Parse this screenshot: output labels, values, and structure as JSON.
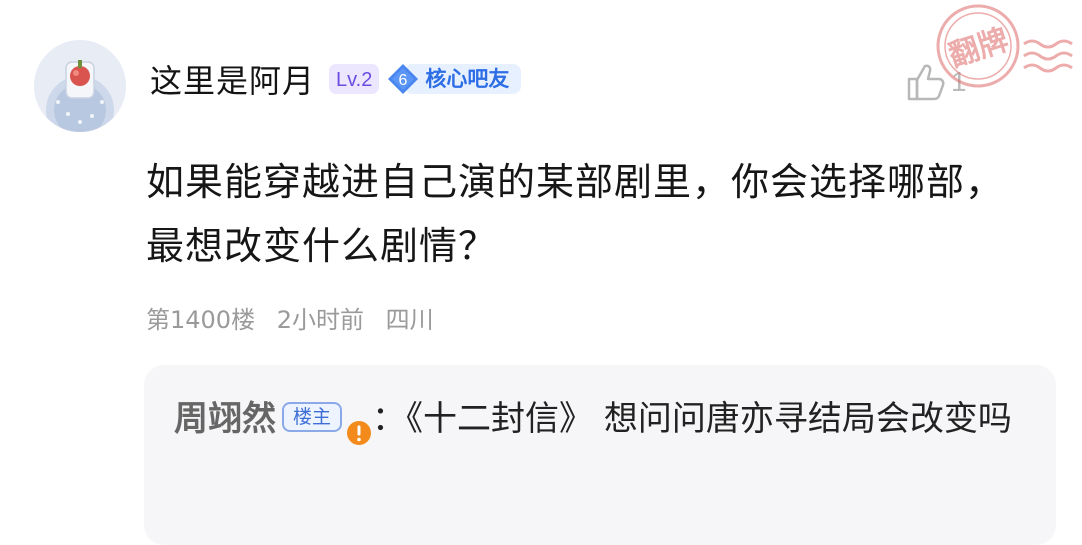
{
  "post": {
    "username": "这里是阿月",
    "level": "Lv.2",
    "fan_level": "6",
    "fan_title": "核心吧友",
    "like_count": "1",
    "content": "如果能穿越进自己演的某部剧里，你会选择哪部，最想改变什么剧情？",
    "floor": "第1400楼",
    "time": "2小时前",
    "location": "四川"
  },
  "reply": {
    "username": "周翊然",
    "badge": "楼主",
    "separator": "：",
    "text": "《十二封信》 想问问唐亦寻结局会改变吗"
  },
  "stamp": {
    "text": "翻牌"
  },
  "colors": {
    "level_bg": "#ece6ff",
    "level_text": "#6a4de0",
    "core_blue": "#2d6ee6",
    "stamp_red": "#e06a6a",
    "warn_orange": "#f28a1c"
  },
  "icons": [
    "avatar",
    "diamond-badge-icon",
    "thumbs-up-icon",
    "warning-icon",
    "fanpai-stamp"
  ]
}
